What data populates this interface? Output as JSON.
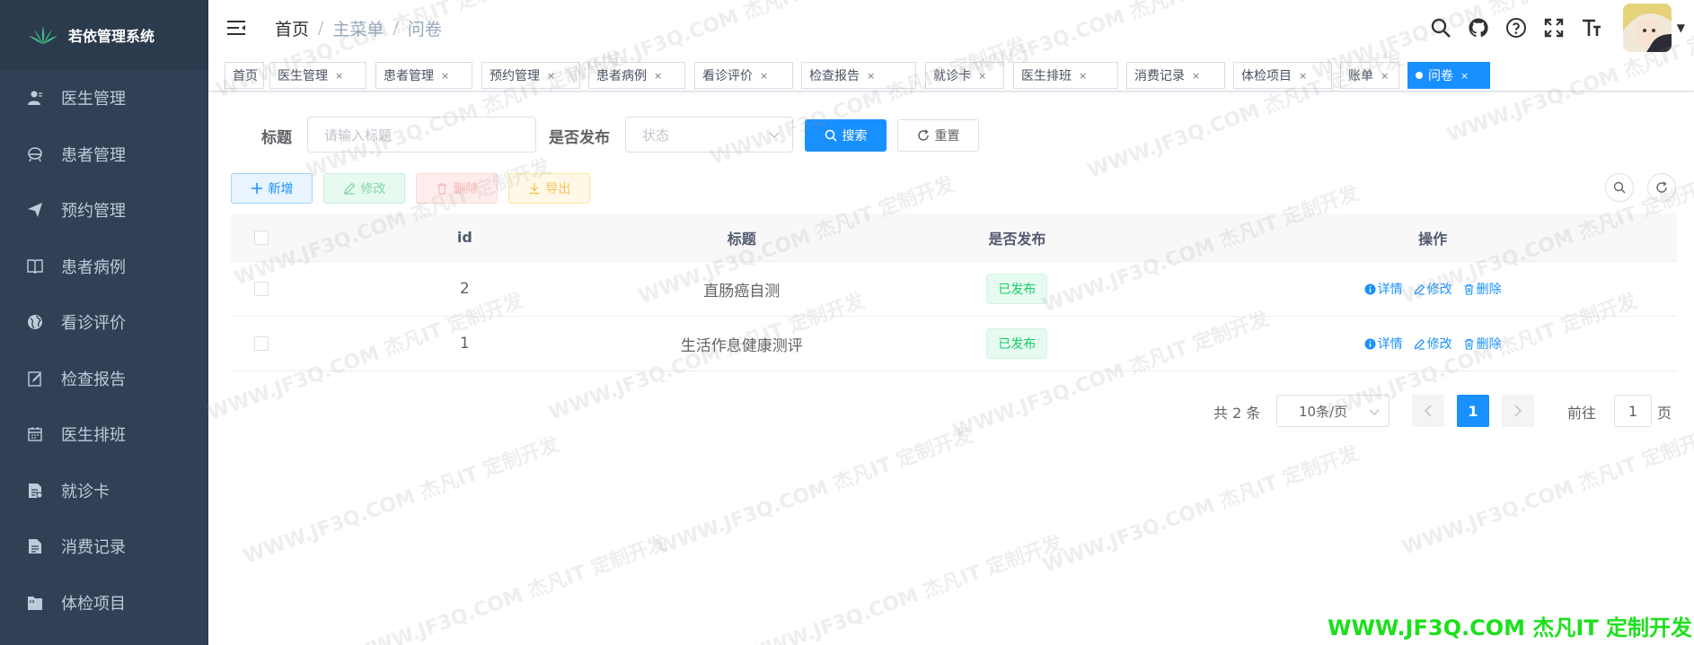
{
  "app": {
    "title": "若依管理系统"
  },
  "sidebar": {
    "items": [
      {
        "label": "医生管理",
        "icon": "user-icon"
      },
      {
        "label": "患者管理",
        "icon": "patient-icon"
      },
      {
        "label": "预约管理",
        "icon": "paper-plane-icon"
      },
      {
        "label": "患者病例",
        "icon": "book-icon"
      },
      {
        "label": "看诊评价",
        "icon": "globe-icon"
      },
      {
        "label": "检查报告",
        "icon": "edit-icon"
      },
      {
        "label": "医生排班",
        "icon": "calendar-icon"
      },
      {
        "label": "就诊卡",
        "icon": "card-icon"
      },
      {
        "label": "消费记录",
        "icon": "document-icon"
      },
      {
        "label": "体检项目",
        "icon": "folder-icon"
      }
    ]
  },
  "breadcrumb": {
    "home": "首页",
    "sep": "/",
    "level1": "主菜单",
    "level2": "问卷"
  },
  "tags": [
    {
      "label": "首页",
      "closable": false
    },
    {
      "label": "医生管理",
      "closable": true
    },
    {
      "label": "患者管理",
      "closable": true
    },
    {
      "label": "预约管理",
      "closable": true
    },
    {
      "label": "患者病例",
      "closable": true
    },
    {
      "label": "看诊评价",
      "closable": true
    },
    {
      "label": "检查报告",
      "closable": true
    },
    {
      "label": "就诊卡",
      "closable": true
    },
    {
      "label": "医生排班",
      "closable": true
    },
    {
      "label": "消费记录",
      "closable": true
    },
    {
      "label": "体检项目",
      "closable": true
    },
    {
      "label": "账单",
      "closable": true
    },
    {
      "label": "问卷",
      "closable": true,
      "active": true
    }
  ],
  "tag_close": "×",
  "search": {
    "title_label": "标题",
    "title_placeholder": "请输入标题",
    "publish_label": "是否发布",
    "publish_placeholder": "状态",
    "search_btn": "搜索",
    "reset_btn": "重置"
  },
  "toolbar": {
    "add": "新增",
    "edit": "修改",
    "delete": "删除",
    "export": "导出"
  },
  "table": {
    "headers": {
      "id": "id",
      "title": "标题",
      "published": "是否发布",
      "ops": "操作"
    },
    "rows": [
      {
        "id": "2",
        "title": "直肠癌自测",
        "published": "已发布"
      },
      {
        "id": "1",
        "title": "生活作息健康测评",
        "published": "已发布"
      }
    ],
    "ops": {
      "detail": "详情",
      "edit": "修改",
      "delete": "删除"
    }
  },
  "pagination": {
    "total": "共 2 条",
    "page_size": "10条/页",
    "current_page": "1",
    "goto_prefix": "前往",
    "goto_value": "1",
    "goto_suffix": "页"
  },
  "watermark": {
    "text": "WWW.JF3Q.COM 杰凡IT  定制开发",
    "footer": "WWW.JF3Q.COM 杰凡IT  定制开发"
  },
  "colors": {
    "sidebar_bg": "#304156",
    "primary": "#1890ff",
    "success": "#13ce66"
  }
}
